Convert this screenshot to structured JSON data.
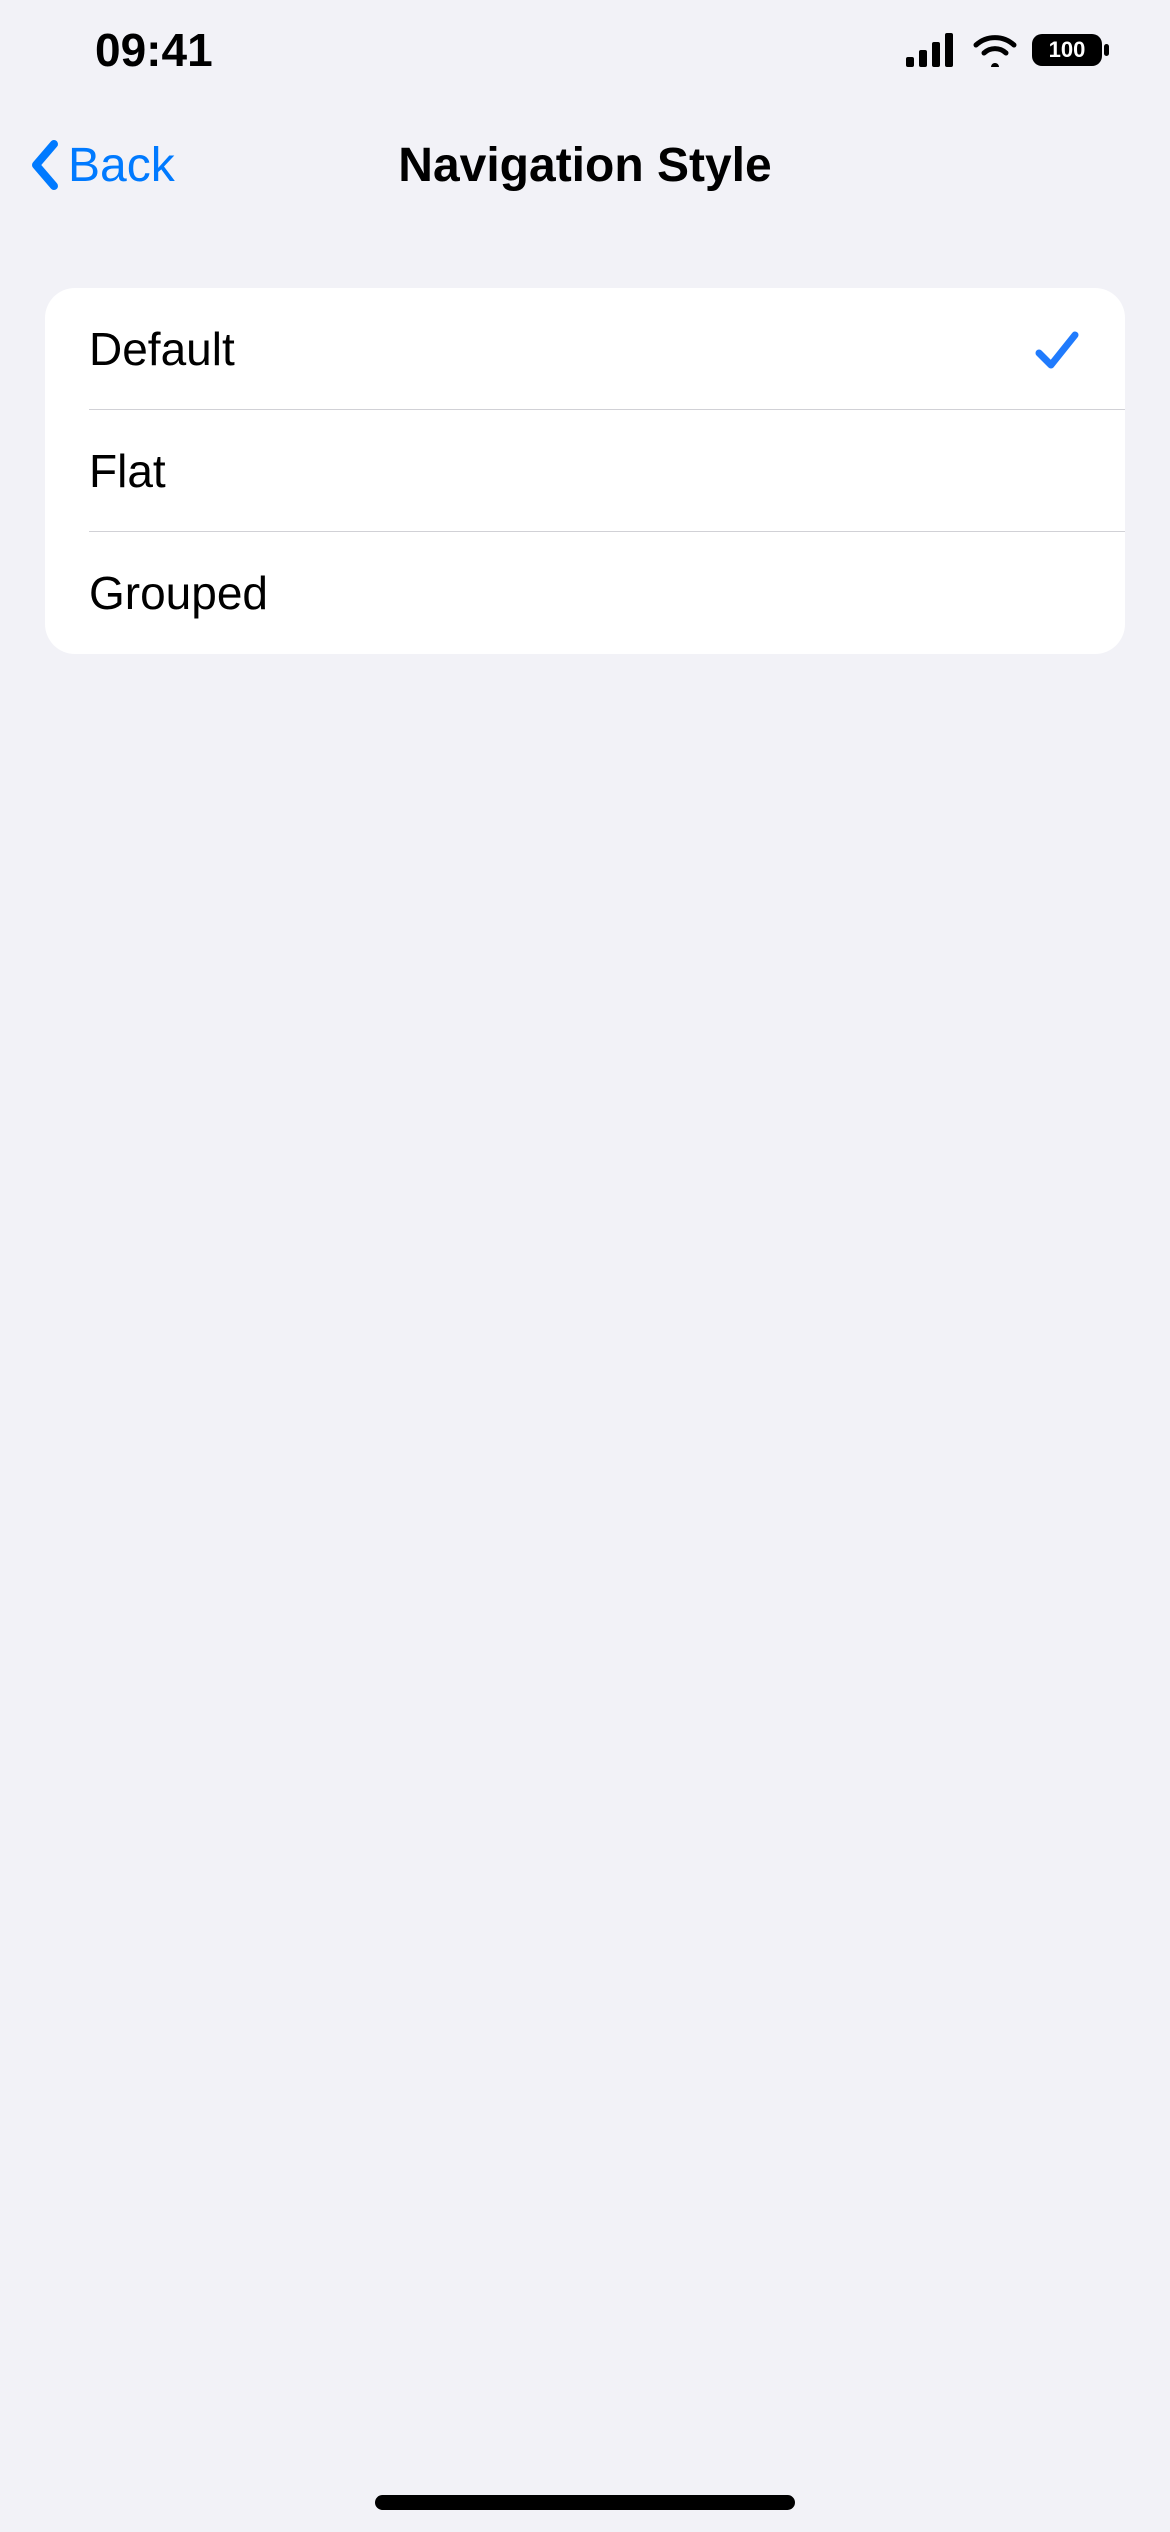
{
  "status": {
    "time": "09:41",
    "battery": "100"
  },
  "nav": {
    "back_label": "Back",
    "title": "Navigation Style"
  },
  "options": [
    {
      "label": "Default",
      "selected": true
    },
    {
      "label": "Flat",
      "selected": false
    },
    {
      "label": "Grouped",
      "selected": false
    }
  ],
  "accent_color": "#007aff"
}
